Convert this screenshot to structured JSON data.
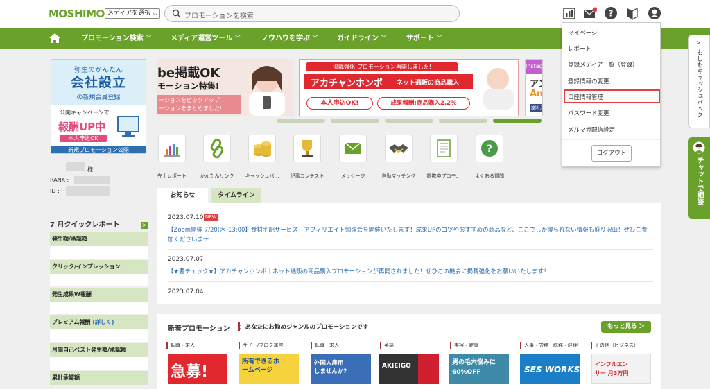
{
  "header": {
    "logo": "MOSHIMO",
    "media_select": "メディアを選択",
    "search_placeholder": "プロモーションを検索"
  },
  "nav": {
    "items": [
      {
        "label": "プロモーション検索"
      },
      {
        "label": "メディア運営ツール"
      },
      {
        "label": "ノウハウを学ぶ"
      },
      {
        "label": "ガイドライン"
      },
      {
        "label": "サポート"
      }
    ],
    "chevron": "﹀"
  },
  "left_banner": {
    "line1": "弥生のかんたん",
    "line2": "会社設立",
    "line3": "の新規会員登録",
    "campaign": "公開キャンペーンで",
    "report": "報酬UP中",
    "badge": "本人申込OK",
    "footer": "新規プロモーション公開"
  },
  "user": {
    "suffix": "様",
    "rank_label": "RANK :",
    "id_label": "ID :"
  },
  "quick_report": {
    "title": "7 月クイックレポート",
    "rows": [
      {
        "label": "発生額/承認額"
      },
      {
        "label": "クリック/インプレッション"
      },
      {
        "label": "発生成果W報酬"
      },
      {
        "label": "プレミアム報酬",
        "link": "(詳しく)"
      },
      {
        "label": "月間自己ベスト発生額/承認額"
      },
      {
        "label": "累計承認額"
      }
    ]
  },
  "carousel": {
    "slide1_line1": "be掲載OK",
    "slide1_line2": "モーション特集!",
    "slide1_line3": "ーションをピックアップ",
    "slide1_line4": "ーションをまとめました!",
    "slide2_top": "掲載強化!プロモーション再開しました!",
    "slide2_brand": "アカチャンホンポ",
    "slide2_sub": "ネット通販の商品購入",
    "slide2_btn1": "本人申込OK!",
    "slide2_btn2": "成果報酬:商品購入2.2%",
    "slide3_top": "Instagram",
    "slide3_line": "アンケ",
    "slide3_brand": "Amaz",
    "slide3_tag": "謝礼獲得"
  },
  "apps": [
    {
      "label": "売上レポート",
      "icon": "bar-chart-icon"
    },
    {
      "label": "かんたんリンク",
      "icon": "link-icon"
    },
    {
      "label": "キャッシュバ…",
      "icon": "coins-icon"
    },
    {
      "label": "記事コンテスト",
      "icon": "trophy-icon"
    },
    {
      "label": "メッセージ",
      "icon": "envelope-icon"
    },
    {
      "label": "自動マッチング",
      "icon": "handshake-icon"
    },
    {
      "label": "提携中プロモ…",
      "icon": "document-icon"
    },
    {
      "label": "よくある質問",
      "icon": "question-icon"
    }
  ],
  "tabs": [
    {
      "label": "お知らせ"
    },
    {
      "label": "タイムライン"
    }
  ],
  "news": [
    {
      "date": "2023.07.10",
      "badge": "NEW",
      "text": "【Zoom開催 7/20(木)13:00】食材宅配サービス　アフィリエイト勉強会を開催いたします！成果UPのコツやおすすめの商品など、ここでしか得られない情報も盛り沢山！ぜひご参加くださいませ"
    },
    {
      "date": "2023.07.07",
      "text": "【★要チェック★】アカチャンホンポ｜ネット通販の商品購入プロモーションが再開されました！ぜひこの機会に掲載強化をお願いいたします！"
    },
    {
      "date": "2023.07.04",
      "text": ""
    }
  ],
  "promotions": {
    "title": "新着プロモーション",
    "subtitle": "：あなたにお勧めジャンルのプロモーションです",
    "more": "もっと見る ＞",
    "items": [
      {
        "category": "転職・求人",
        "caption": "急募!",
        "color": "#e0282e"
      },
      {
        "category": "サイト/ブログ運営",
        "caption": "所有できるホームページ",
        "color": "#f6d33c"
      },
      {
        "category": "転職・求人",
        "caption": "外国人雇用しませんか?",
        "color": "#3a6fb8"
      },
      {
        "category": "英語",
        "caption": "AKIEIGO",
        "color": "#333333"
      },
      {
        "category": "美容・健康",
        "caption": "男の毛穴悩みに 60%OFF",
        "color": "#3e8aa8"
      },
      {
        "category": "人事・労務・総務・経理",
        "caption": "SES WORKS",
        "color": "#1a7fc8"
      },
      {
        "category": "その他（ビジネス）",
        "caption": "インフルエンサー 月3万円",
        "color": "#f2f2f2"
      }
    ]
  },
  "dropdown": {
    "items": [
      {
        "label": "マイページ"
      },
      {
        "label": "レポート"
      },
      {
        "label": "登録メディア一覧（登録）"
      },
      {
        "label": "登録情報の変更"
      },
      {
        "label": "口座情報管理"
      },
      {
        "label": "パスワード変更"
      },
      {
        "label": "メルマガ配信設定"
      }
    ],
    "logout": "ログアウト"
  },
  "side_tabs": {
    "cashback": "もしもキャッシュバック",
    "chat": "チャットで相談"
  },
  "colors": {
    "brand_green": "#6aa12a",
    "link_blue": "#2d6fb0",
    "highlight_red": "#e04040"
  }
}
